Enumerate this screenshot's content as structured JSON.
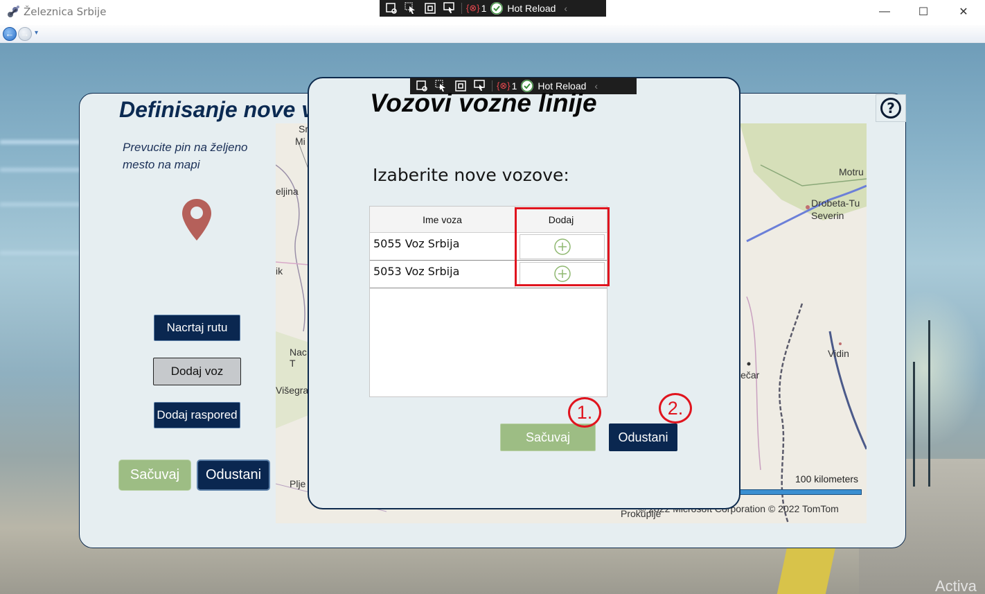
{
  "window": {
    "title": "Železnica Srbije",
    "controls": {
      "minimize": "—",
      "maximize": "☐",
      "close": "✕"
    }
  },
  "debug_toolbar": {
    "error_count": "1",
    "hot_reload": "Hot Reload"
  },
  "main": {
    "title": "Definisanje nove vozne linije",
    "instruction": "Prevucite pin na željeno mesto na mapi",
    "buttons": {
      "draw_route": "Nacrtaj rutu",
      "add_train": "Dodaj voz",
      "add_schedule": "Dodaj raspored",
      "save": "Sačuvaj",
      "cancel": "Odustani"
    },
    "help": "?"
  },
  "map": {
    "labels": [
      "Sr",
      "Mi",
      "eljina",
      "ik",
      "Nac",
      "T",
      "Višegra",
      "Plje",
      "Motru",
      "Drobeta-Tu",
      "Severin",
      "Vidin",
      "ječar",
      "Prokuplje"
    ],
    "scale": "100 kilometers",
    "copyright": "© 2022 Microsoft Corporation   © 2022 TomTom"
  },
  "modal": {
    "title": "Vozovi vozne linije",
    "subtitle": "Izaberite nove vozove:",
    "columns": [
      "Ime voza",
      "Dodaj"
    ],
    "rows": [
      {
        "name": "5055 Voz Srbija"
      },
      {
        "name": "5053 Voz Srbija"
      }
    ],
    "save": "Sačuvaj",
    "cancel": "Odustani"
  },
  "annotations": {
    "step1": "1.",
    "step2": "2."
  },
  "watermark": "Activa",
  "colors": {
    "navy": "#0a2750",
    "green": "#9dbd84",
    "highlight_red": "#e0141e",
    "panel": "#e6eef1"
  },
  "icons": [
    "app-icon",
    "back-arrow-icon",
    "forward-arrow-icon",
    "map-pin-icon",
    "help-icon",
    "plus-circle-icon",
    "hot-reload-check-icon"
  ]
}
